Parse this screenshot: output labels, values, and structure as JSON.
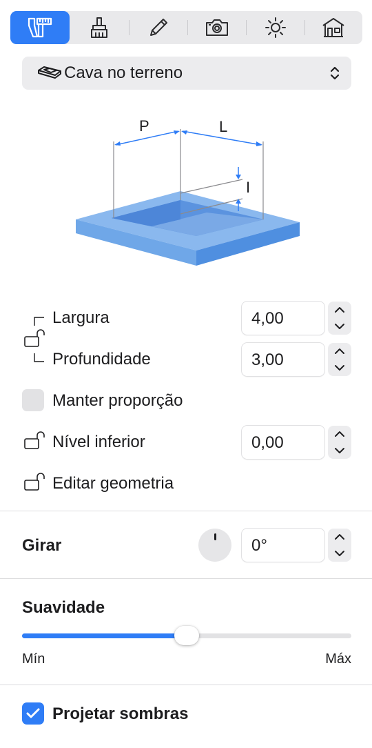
{
  "tabs": [
    {
      "icon": "measure-tools-icon",
      "active": true
    },
    {
      "icon": "paint-brush-icon",
      "active": false
    },
    {
      "icon": "pencil-icon",
      "active": false
    },
    {
      "icon": "camera-icon",
      "active": false
    },
    {
      "icon": "sun-icon",
      "active": false
    },
    {
      "icon": "house-icon",
      "active": false
    }
  ],
  "object_selector": {
    "icon": "terrain-cut-icon",
    "label": "Cava no terreno"
  },
  "diagram": {
    "label_p": "P",
    "label_l": "L",
    "label_i": "I"
  },
  "dimensions": {
    "width_label": "Largura",
    "width_value": "4,00",
    "depth_label": "Profundidade",
    "depth_value": "3,00",
    "keep_ratio_label": "Manter proporção",
    "bottom_level_label": "Nível inferior",
    "bottom_level_value": "0,00",
    "edit_geometry_label": "Editar geometria"
  },
  "rotate": {
    "label": "Girar",
    "value": "0°"
  },
  "smoothness": {
    "label": "Suavidade",
    "min_label": "Mín",
    "max_label": "Máx",
    "level": 0.5
  },
  "shadows": {
    "label": "Projetar sombras",
    "checked": true
  },
  "colors": {
    "accent": "#2f7df6",
    "terrain_top": "#8ab8ee",
    "terrain_side": "#5a9be8",
    "pit_floor": "#6197de"
  }
}
